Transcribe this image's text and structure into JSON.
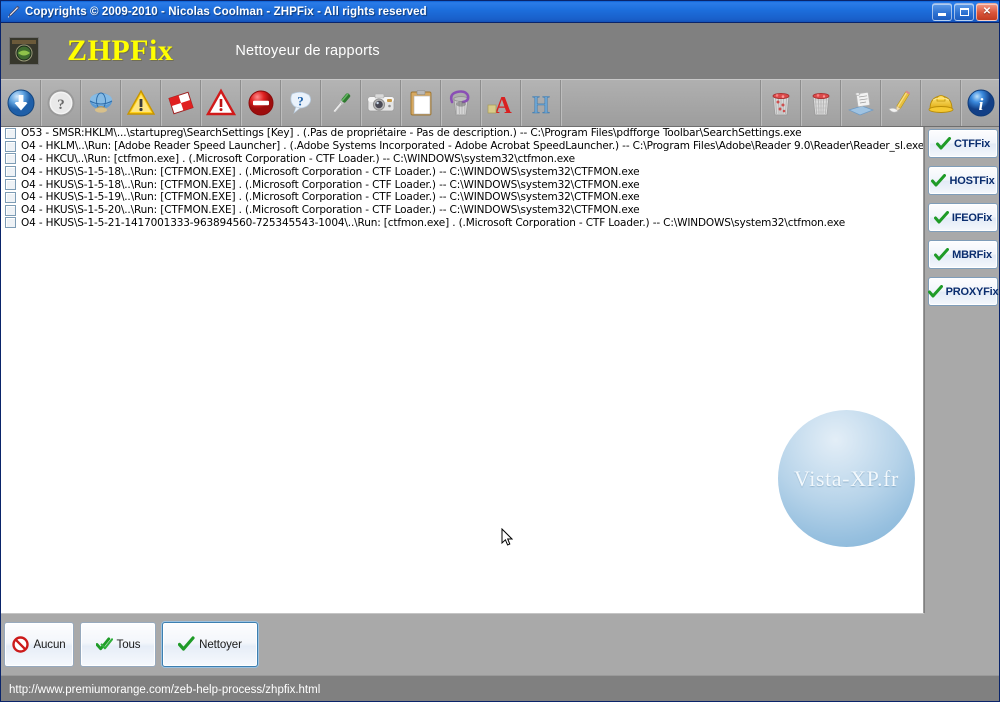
{
  "window": {
    "title": "Copyrights © 2009-2010 - Nicolas Coolman - ZHPFix - All rights reserved",
    "title_icon": "pen-icon",
    "minimize_label": "Minimize",
    "maximize_label": "Maximize",
    "close_label": "Close"
  },
  "header": {
    "logo_icon": "zhpfix-globe-logo-icon",
    "app_name": "ZHPFix",
    "subtitle": "Nettoyeur de rapports"
  },
  "toolbar": {
    "buttons": [
      {
        "icon": "blue-down-arrow-icon",
        "name": "download-button"
      },
      {
        "icon": "gray-question-circle-icon",
        "name": "help-button"
      },
      {
        "icon": "blue-globe-icon",
        "name": "web-button"
      },
      {
        "icon": "yellow-warning-triangle-icon",
        "name": "warning-button"
      },
      {
        "icon": "red-white-checkered-flag-icon",
        "name": "flag-button"
      },
      {
        "icon": "red-warning-triangle-icon",
        "name": "alert-button"
      },
      {
        "icon": "red-stop-sign-icon",
        "name": "stop-button"
      },
      {
        "icon": "blue-question-balloon-icon",
        "name": "about-button"
      },
      {
        "icon": "screwdriver-icon",
        "name": "tools-button"
      },
      {
        "icon": "camera-icon",
        "name": "screenshot-button"
      },
      {
        "icon": "clipboard-icon",
        "name": "clipboard-button"
      },
      {
        "icon": "wastebasket-icon",
        "name": "trash-button"
      },
      {
        "icon": "red-letter-a-icon",
        "name": "font-button"
      },
      {
        "icon": "blue-letter-h-icon",
        "name": "host-button"
      }
    ],
    "buttons_right": [
      {
        "icon": "red-full-bin-icon",
        "name": "empty-recyclebin-button"
      },
      {
        "icon": "red-full-bin-2-icon",
        "name": "empty-temp-button"
      },
      {
        "icon": "paper-scroll-icon",
        "name": "report-button"
      },
      {
        "icon": "pencil-icon",
        "name": "edit-button"
      },
      {
        "icon": "yellow-hardhat-icon",
        "name": "repair-button"
      },
      {
        "icon": "blue-info-icon",
        "name": "info-button"
      }
    ]
  },
  "list": {
    "items": [
      {
        "checked": false,
        "text": "O53 - SMSR:HKLM\\...\\startupreg\\SearchSettings [Key] . (.Pas de propriétaire - Pas de description.) -- C:\\Program Files\\pdfforge Toolbar\\SearchSettings.exe"
      },
      {
        "checked": false,
        "text": "O4 - HKLM\\..\\Run: [Adobe Reader Speed Launcher] . (.Adobe Systems Incorporated - Adobe Acrobat SpeedLauncher.) -- C:\\Program Files\\Adobe\\Reader 9.0\\Reader\\Reader_sl.exe"
      },
      {
        "checked": false,
        "text": "O4 - HKCU\\..\\Run: [ctfmon.exe] . (.Microsoft Corporation - CTF Loader.) -- C:\\WINDOWS\\system32\\ctfmon.exe"
      },
      {
        "checked": false,
        "text": "O4 - HKUS\\S-1-5-18\\..\\Run: [CTFMON.EXE] . (.Microsoft Corporation - CTF Loader.) -- C:\\WINDOWS\\system32\\CTFMON.exe"
      },
      {
        "checked": false,
        "text": "O4 - HKUS\\S-1-5-18\\..\\Run: [CTFMON.EXE] . (.Microsoft Corporation - CTF Loader.) -- C:\\WINDOWS\\system32\\CTFMON.exe"
      },
      {
        "checked": false,
        "text": "O4 - HKUS\\S-1-5-19\\..\\Run: [CTFMON.EXE] . (.Microsoft Corporation - CTF Loader.) -- C:\\WINDOWS\\system32\\CTFMON.exe"
      },
      {
        "checked": false,
        "text": "O4 - HKUS\\S-1-5-20\\..\\Run: [CTFMON.EXE] . (.Microsoft Corporation - CTF Loader.) -- C:\\WINDOWS\\system32\\CTFMON.exe"
      },
      {
        "checked": false,
        "text": "O4 - HKUS\\S-1-5-21-1417001333-963894560-725345543-1004\\..\\Run: [ctfmon.exe] . (.Microsoft Corporation - CTF Loader.) -- C:\\WINDOWS\\system32\\ctfmon.exe"
      }
    ],
    "watermark": "Vista-XP.fr"
  },
  "sidepanel": {
    "buttons": [
      {
        "label": "CTFFix",
        "icon": "green-check-icon"
      },
      {
        "label": "HOSTFix",
        "icon": "green-check-icon"
      },
      {
        "label": "IFEOFix",
        "icon": "green-check-icon"
      },
      {
        "label": "MBRFix",
        "icon": "green-check-icon"
      },
      {
        "label": "PROXYFix",
        "icon": "green-check-icon"
      }
    ]
  },
  "bottombar": {
    "buttons": [
      {
        "label": "Aucun",
        "icon": "red-no-entry-icon",
        "focused": false
      },
      {
        "label": "Tous",
        "icon": "green-double-check-icon",
        "focused": false
      },
      {
        "label": "Nettoyer",
        "icon": "green-check-icon",
        "focused": true
      }
    ]
  },
  "statusbar": {
    "text": "http://www.premiumorange.com/zeb-help-process/zhpfix.html"
  },
  "colors": {
    "title_bar": "#1d6fdd",
    "window_bg": "#808080",
    "toolbar_bg": "#a9a9a9",
    "list_bg": "#ffffff",
    "app_name": "#ffff00",
    "side_label": "#0a2d6e",
    "accent_green": "#1f9b27",
    "accent_red": "#cc1a1a"
  }
}
